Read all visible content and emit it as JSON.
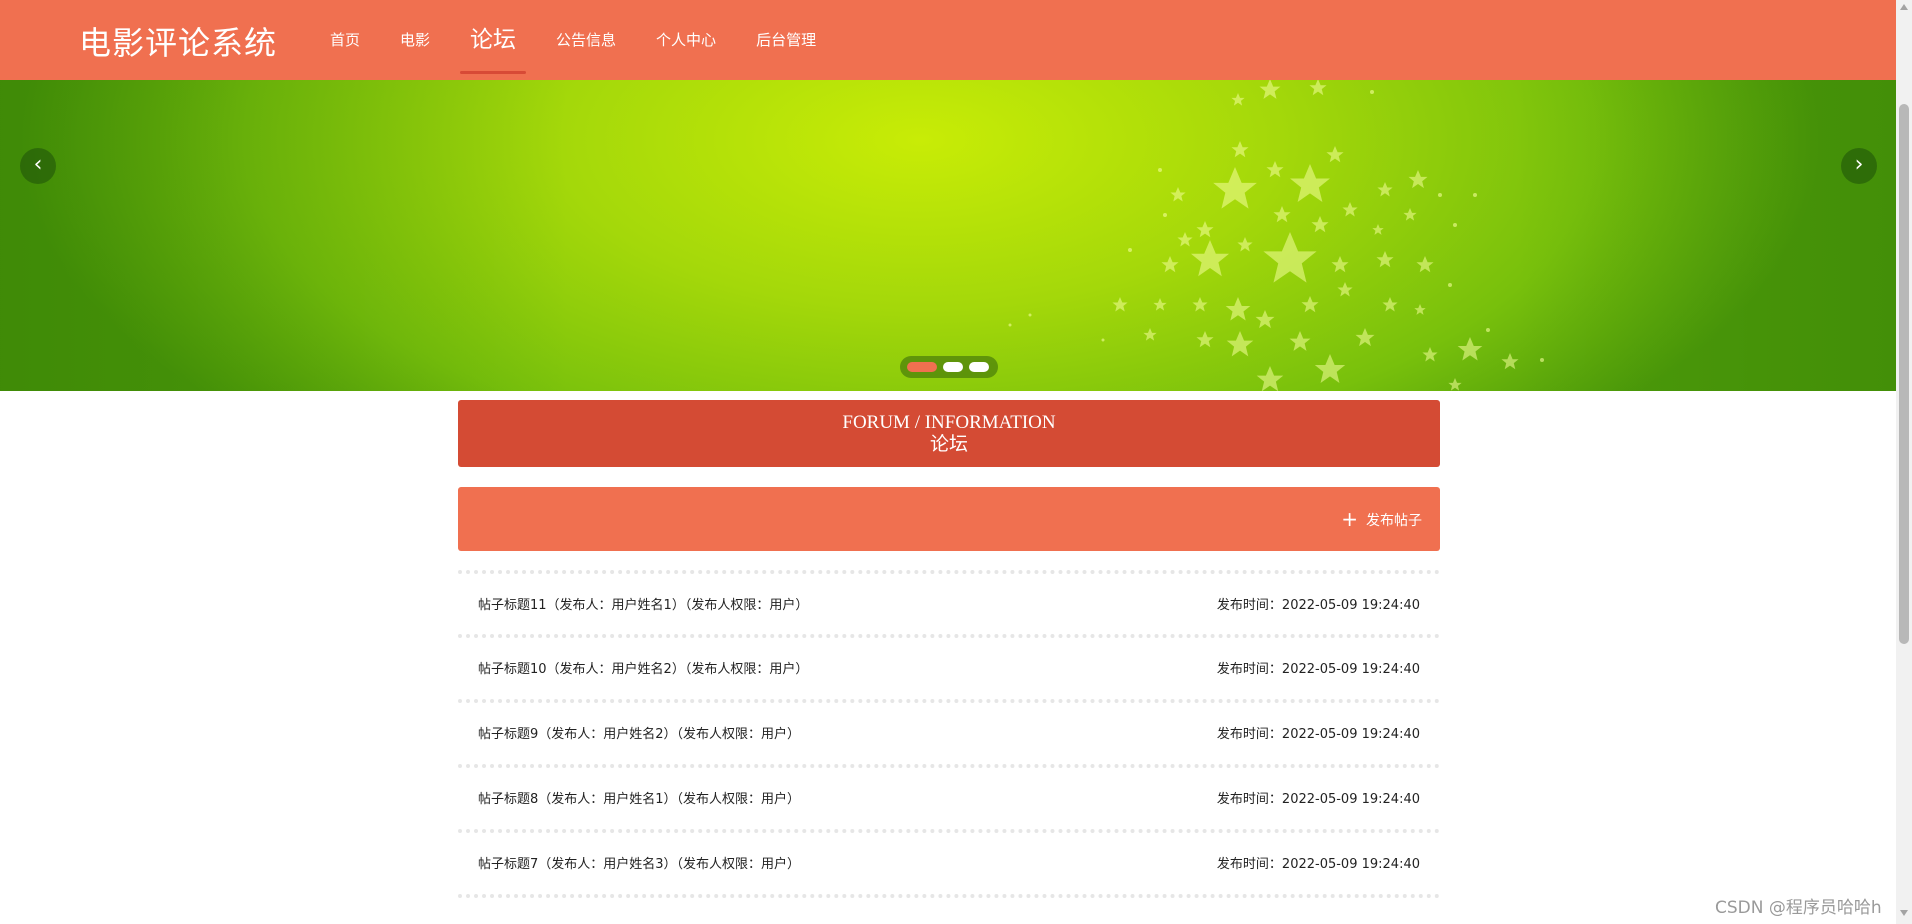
{
  "site": {
    "logo": "电影评论系统"
  },
  "nav": {
    "items": [
      {
        "label": "首页"
      },
      {
        "label": "电影"
      },
      {
        "label": "论坛"
      },
      {
        "label": "公告信息"
      },
      {
        "label": "个人中心"
      },
      {
        "label": "后台管理"
      }
    ],
    "active_index": 2
  },
  "banner": {
    "prev_icon": "chevron-left-icon",
    "next_icon": "chevron-right-icon",
    "slide_count": 3,
    "active_slide": 1
  },
  "section": {
    "title_en": "FORUM / INFORMATION",
    "title_cn": "论坛"
  },
  "actions": {
    "post_label": "发布帖子",
    "post_icon": "plus-icon"
  },
  "posts": [
    {
      "title": "帖子标题11（发布人：用户姓名1）（发布人权限：用户）",
      "time": "发布时间：2022-05-09 19:24:40"
    },
    {
      "title": "帖子标题10（发布人：用户姓名2）（发布人权限：用户）",
      "time": "发布时间：2022-05-09 19:24:40"
    },
    {
      "title": "帖子标题9（发布人：用户姓名2）（发布人权限：用户）",
      "time": "发布时间：2022-05-09 19:24:40"
    },
    {
      "title": "帖子标题8（发布人：用户姓名1）（发布人权限：用户）",
      "time": "发布时间：2022-05-09 19:24:40"
    },
    {
      "title": "帖子标题7（发布人：用户姓名3）（发布人权限：用户）",
      "time": "发布时间：2022-05-09 19:24:40"
    }
  ],
  "watermark": "CSDN @程序员哈哈h",
  "colors": {
    "header": "#f07050",
    "title_bar": "#d44b34",
    "action_bar": "#f07050",
    "active_slide_dot": "#f07050"
  }
}
